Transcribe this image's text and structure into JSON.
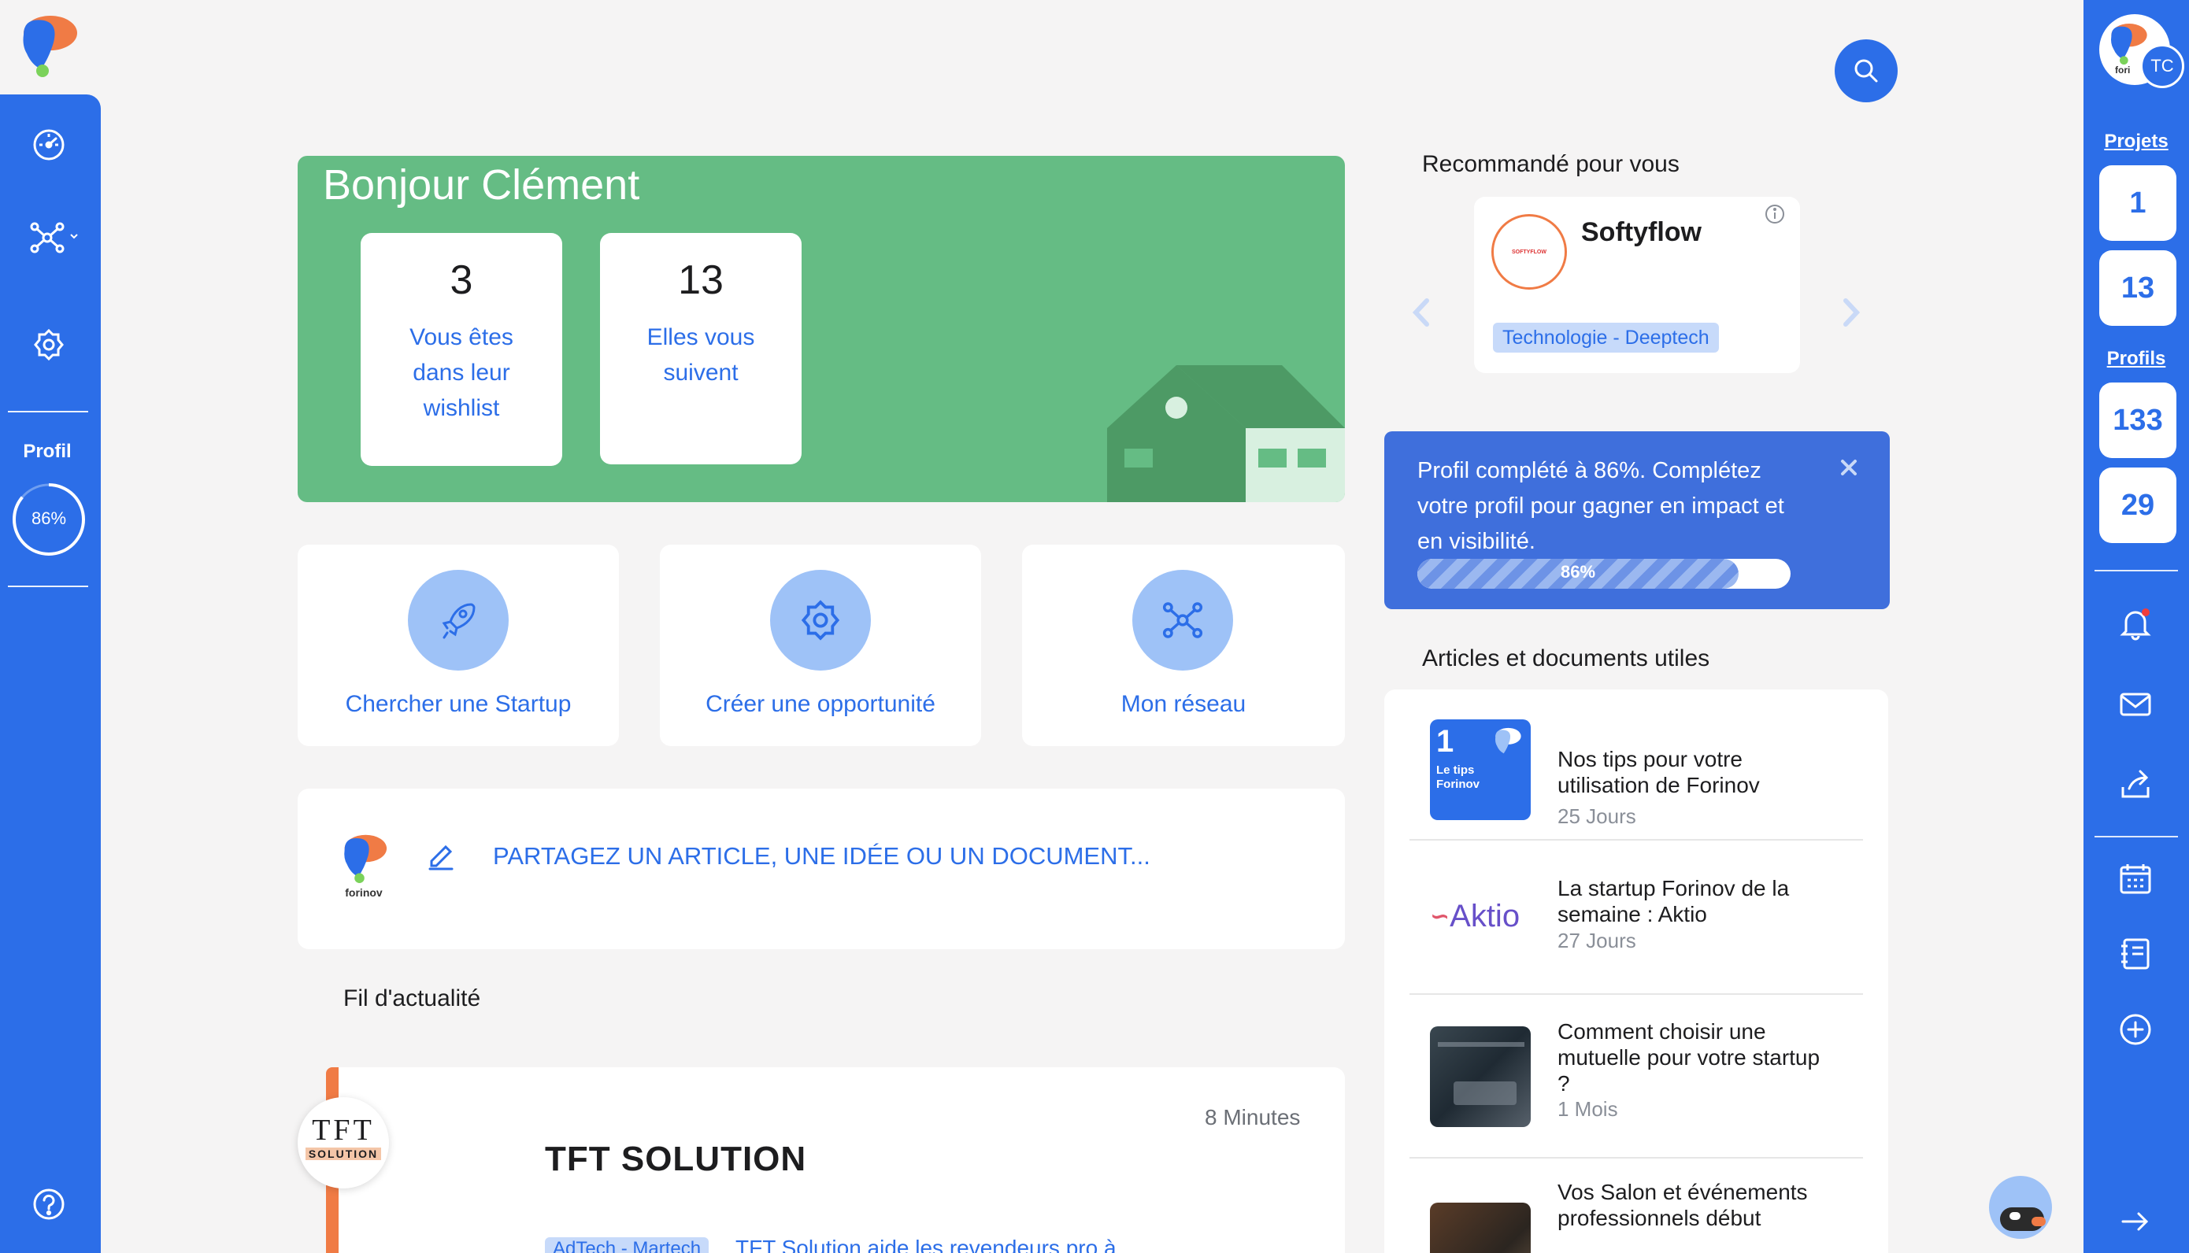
{
  "sidebar_left": {
    "items": [
      {
        "icon": "dashboard-icon"
      },
      {
        "icon": "network-icon"
      },
      {
        "icon": "gear-badge-icon"
      }
    ],
    "profil_label": "Profil",
    "profil_progress_text": "86%",
    "profil_progress": 0.86,
    "help_icon": "question-icon"
  },
  "header": {
    "search_icon": "search-icon"
  },
  "hero": {
    "greeting": "Bonjour Clément",
    "stats": [
      {
        "value": "3",
        "label": "Vous êtes dans leur wishlist"
      },
      {
        "value": "13",
        "label": "Elles vous suivent"
      }
    ]
  },
  "actions": [
    {
      "label": "Chercher une Startup",
      "icon": "rocket-icon"
    },
    {
      "label": "Créer une opportunité",
      "icon": "gear-badge-icon"
    },
    {
      "label": "Mon réseau",
      "icon": "network-icon"
    }
  ],
  "share": {
    "logo_text": "forinov",
    "prompt": "PARTAGEZ UN ARTICLE, UNE IDÉE OU UN DOCUMENT..."
  },
  "feed": {
    "title": "Fil d'actualité",
    "post": {
      "logo_text": "TFT",
      "logo_sub": "SOLUTION",
      "time": "8 Minutes",
      "company": "TFT SOLUTION",
      "tag": "AdTech - Martech",
      "excerpt": "TFT Solution aide les revendeurs pro à"
    }
  },
  "recommended": {
    "title": "Recommandé pour vous",
    "company": "Softyflow",
    "tag": "Technologie - Deeptech",
    "logo_text": "SOFTYFLOW"
  },
  "profile_banner": {
    "text": "Profil complété à 86%. Complétez votre profil pour gagner en impact et en visibilité.",
    "progress_text": "86%",
    "progress": 0.86
  },
  "articles": {
    "title": "Articles et documents utiles",
    "items": [
      {
        "title": "Nos tips pour votre utilisation de Forinov",
        "date": "25 Jours",
        "thumb_num": "1",
        "thumb_text": "Le tips Forinov"
      },
      {
        "title": "La startup Forinov de la semaine : Aktio",
        "date": "27 Jours",
        "thumb_text": "Aktio"
      },
      {
        "title": "Comment choisir une mutuelle pour votre startup ?",
        "date": "1 Mois"
      },
      {
        "title": "Vos Salon et événements professionnels début",
        "date": ""
      }
    ]
  },
  "sidebar_right": {
    "avatar_initials": "TC",
    "avatar_small": "fori",
    "projets_label": "Projets",
    "projets": [
      "1",
      "13"
    ],
    "profils_label": "Profils",
    "profils": [
      "133",
      "29"
    ],
    "icons": [
      "bell-icon",
      "mail-icon",
      "export-icon",
      "calendar-icon",
      "notebook-icon",
      "plus-circle-icon",
      "logout-arrow-icon"
    ]
  },
  "colors": {
    "primary": "#2c6ee8",
    "hero_green": "#65bc84",
    "accent_orange": "#f07b45",
    "banner_blue": "#3f6fdc"
  }
}
